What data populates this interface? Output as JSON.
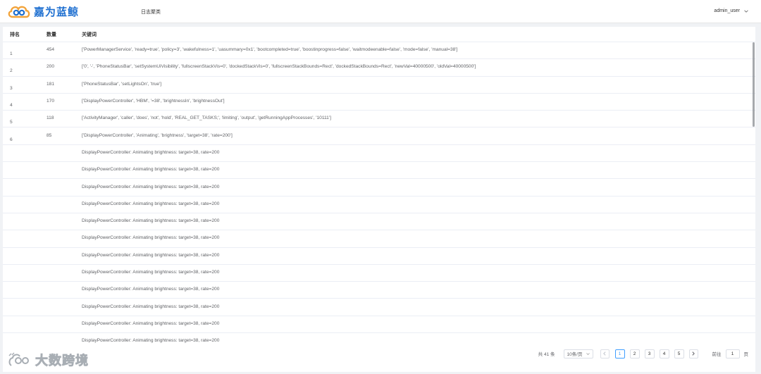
{
  "header": {
    "logo_text": "嘉为蓝鲸",
    "nav_item": "日志聚类",
    "user": "admin_user"
  },
  "table": {
    "columns": {
      "rank": "排名",
      "count": "数量",
      "keywords": "关键词"
    },
    "rows": [
      {
        "rank": "1",
        "count": "454",
        "kw": "['PowerManagerService', 'ready=true', 'policy=3', 'wakefulness=1', 'uasummary=0x1', 'bootcompleted=true', 'boostinprogress=false', 'waitmodeenable=false', 'mode=false', 'manual=38']"
      },
      {
        "rank": "2",
        "count": "200",
        "kw": "['0', '-', 'PhoneStatusBar', 'setSystemUiVisibility', 'fullscreenStackVis=0', 'dockedStackVis=0', 'fullscreenStackBounds=Rect', 'dockedStackBounds=Rect', 'newVal=40000500', 'oldVal=40000500']"
      },
      {
        "rank": "3",
        "count": "181",
        "kw": "['PhoneStatusBar', 'setLightsOn', 'true']"
      },
      {
        "rank": "4",
        "count": "170",
        "kw": "['DisplayPowerController', 'HBM', '=38', 'brightnessIn', 'brightnessOut']"
      },
      {
        "rank": "5",
        "count": "118",
        "kw": "['ActivityManager', 'caller', 'does', 'not', 'hold', 'REAL_GET_TASKS;', 'limiting', 'output', 'getRunningAppProcesses', '10111']"
      },
      {
        "rank": "6",
        "count": "85",
        "kw": "['DisplayPowerController', 'Animating', 'brightness', 'target=38', 'rate=200']"
      },
      {
        "rank": "",
        "count": "",
        "kw": "DisplayPowerController: Animating brightness: target=38, rate=200"
      },
      {
        "rank": "",
        "count": "",
        "kw": "DisplayPowerController: Animating brightness: target=38, rate=200"
      },
      {
        "rank": "",
        "count": "",
        "kw": "DisplayPowerController: Animating brightness: target=38, rate=200"
      },
      {
        "rank": "",
        "count": "",
        "kw": "DisplayPowerController: Animating brightness: target=38, rate=200"
      },
      {
        "rank": "",
        "count": "",
        "kw": "DisplayPowerController: Animating brightness: target=38, rate=200"
      },
      {
        "rank": "",
        "count": "",
        "kw": "DisplayPowerController: Animating brightness: target=38, rate=200"
      },
      {
        "rank": "",
        "count": "",
        "kw": "DisplayPowerController: Animating brightness: target=38, rate=200"
      },
      {
        "rank": "",
        "count": "",
        "kw": "DisplayPowerController: Animating brightness: target=38, rate=200"
      },
      {
        "rank": "",
        "count": "",
        "kw": "DisplayPowerController: Animating brightness: target=38, rate=200"
      },
      {
        "rank": "",
        "count": "",
        "kw": "DisplayPowerController: Animating brightness: target=38, rate=200"
      },
      {
        "rank": "",
        "count": "",
        "kw": "DisplayPowerController: Animating brightness: target=38, rate=200"
      },
      {
        "rank": "",
        "count": "",
        "kw": "DisplayPowerController: Animating brightness: target=38, rate=200"
      }
    ]
  },
  "pagination": {
    "total": "共 41 条",
    "page_size": "10条/页",
    "pages": [
      "1",
      "2",
      "3",
      "4",
      "5"
    ],
    "current": "1",
    "goto_label": "前往",
    "goto_value": "1",
    "goto_suffix": "页"
  },
  "watermark": {
    "text": "大数跨境"
  },
  "colors": {
    "brand": "#1e6fd0",
    "active": "#409eff",
    "border": "#ebeef5"
  }
}
